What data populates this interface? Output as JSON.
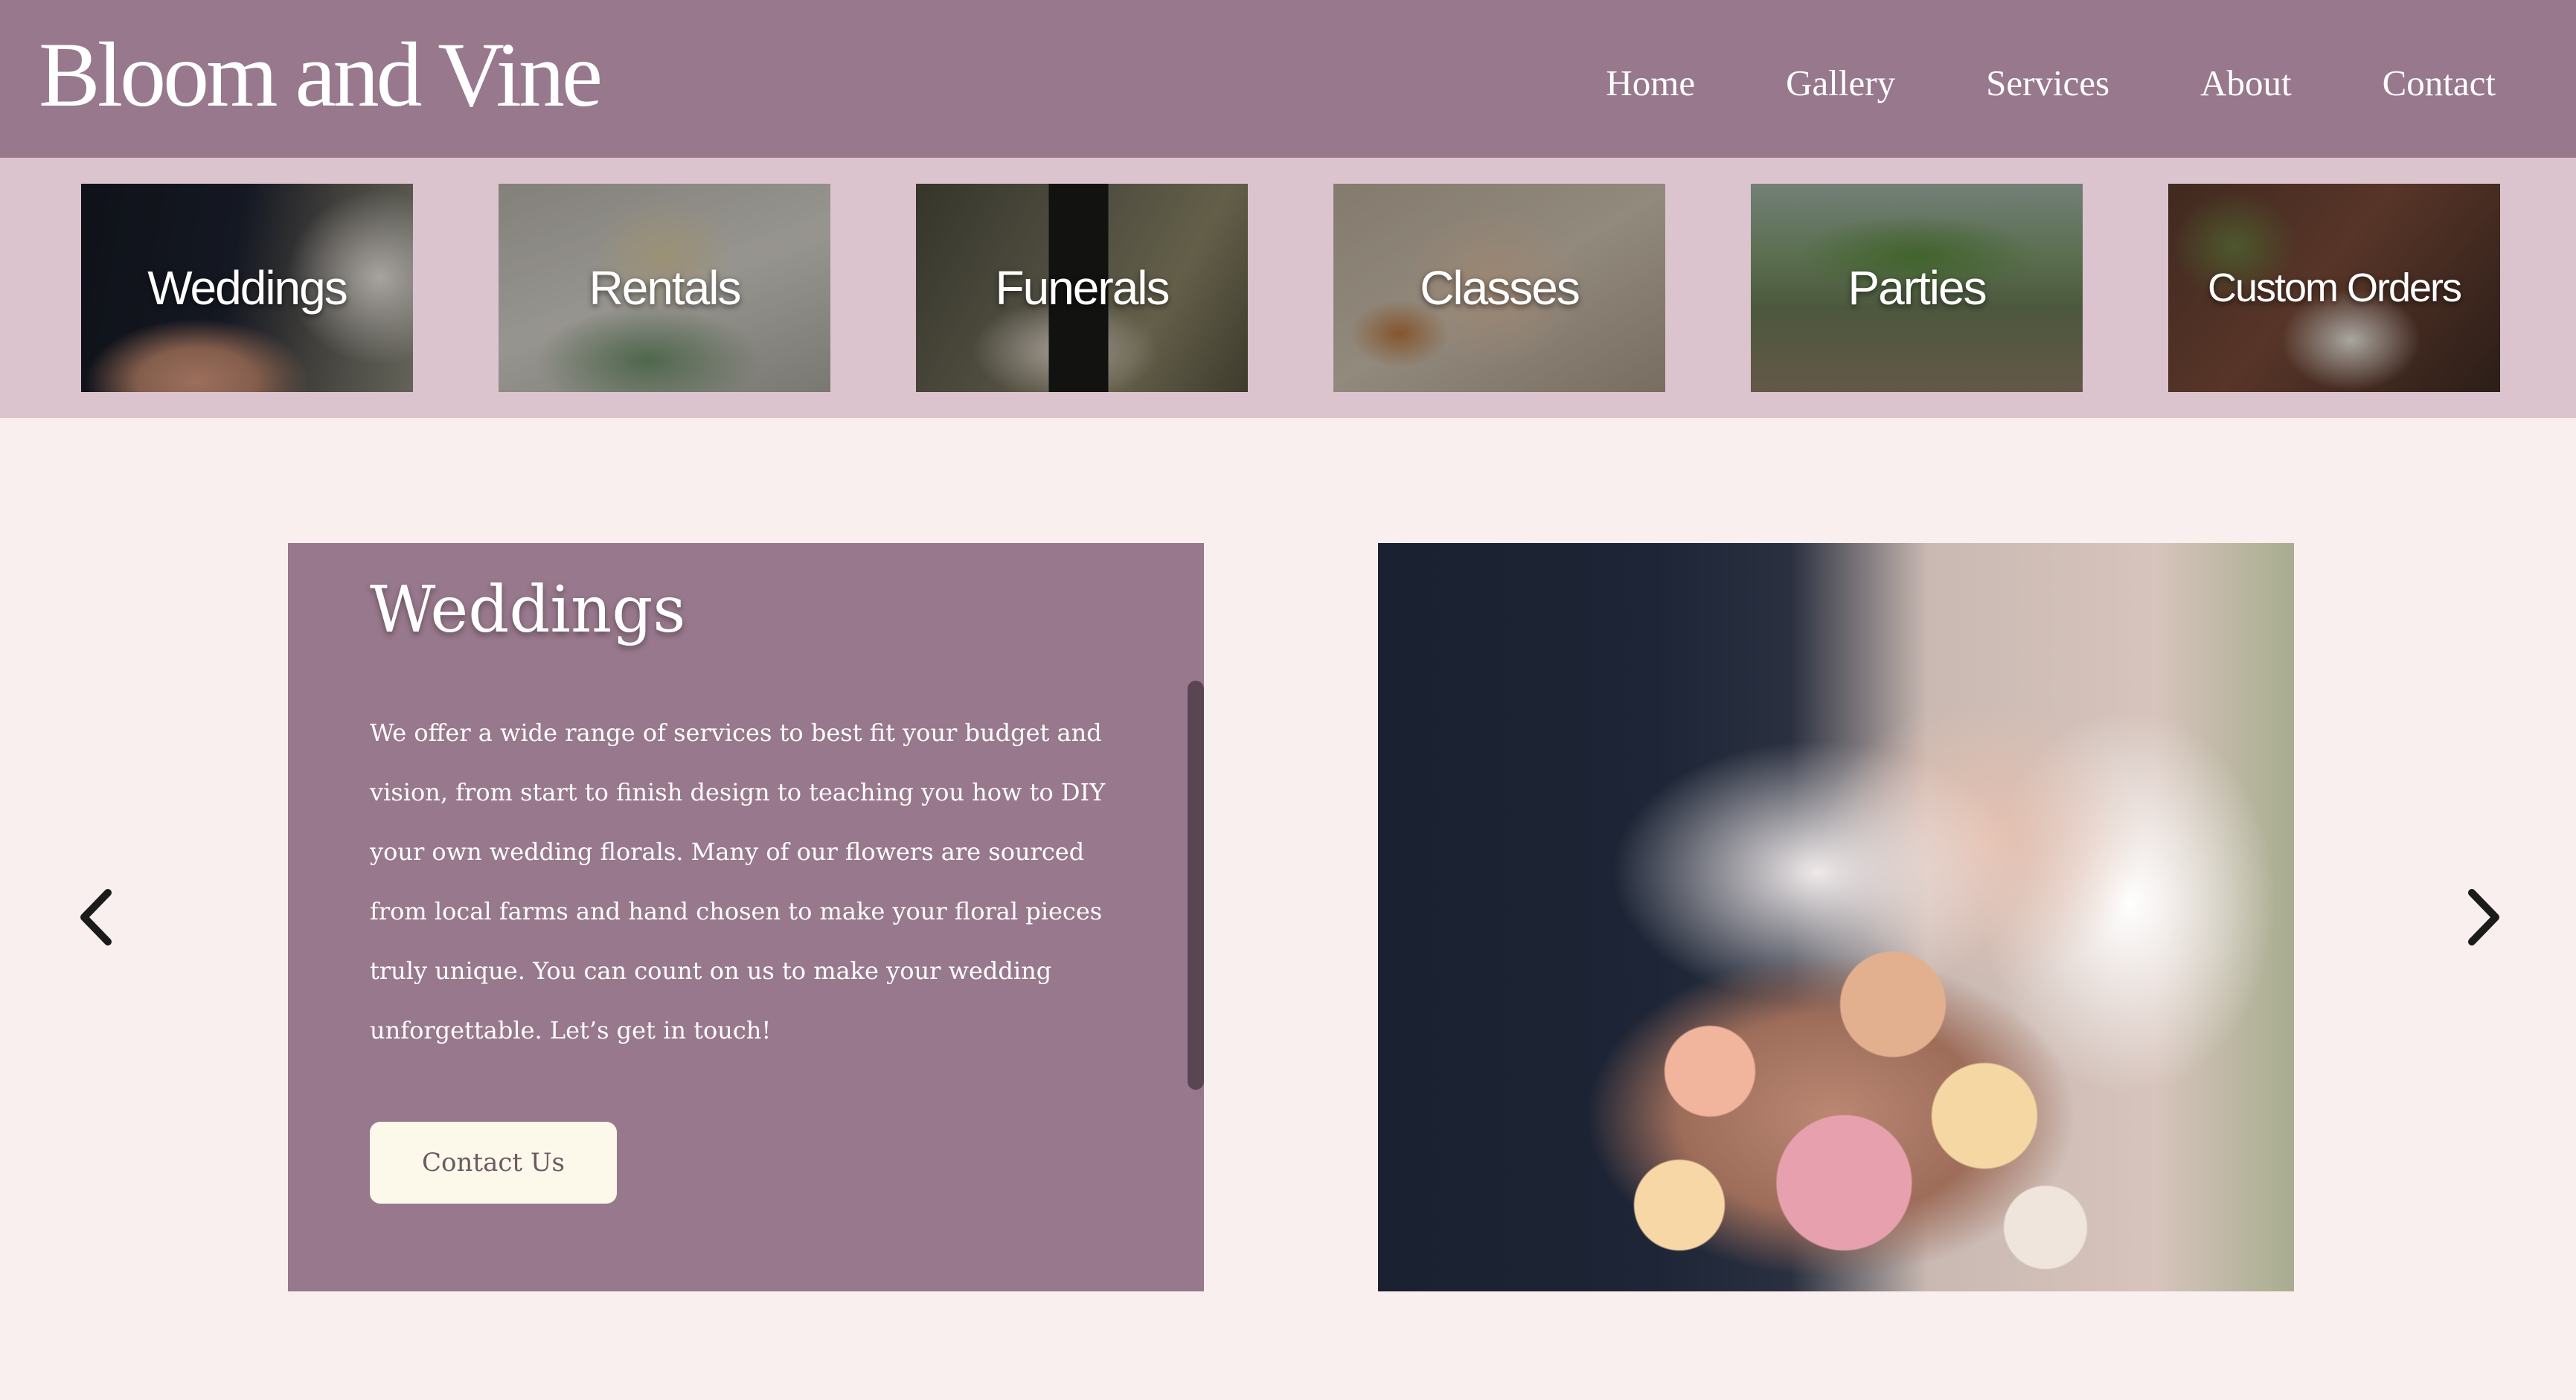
{
  "brand": {
    "logo_text": "Bloom and Vine"
  },
  "nav": {
    "items": [
      {
        "label": "Home"
      },
      {
        "label": "Gallery"
      },
      {
        "label": "Services"
      },
      {
        "label": "About"
      },
      {
        "label": "Contact"
      }
    ]
  },
  "categories": [
    {
      "label": "Weddings"
    },
    {
      "label": "Rentals"
    },
    {
      "label": "Funerals"
    },
    {
      "label": "Classes"
    },
    {
      "label": "Parties"
    },
    {
      "label": "Custom Orders"
    }
  ],
  "feature": {
    "title": "Weddings",
    "body": "We offer a wide range of services to best fit your budget and vision, from start to finish design to teaching you how to DIY your own wedding florals. Many of our flowers are sourced from local farms and hand chosen to make your floral pieces truly unique. You can count on us to make your wedding unforgettable. Let’s get in touch!",
    "cta_label": "Contact Us"
  },
  "carousel": {
    "prev_icon": "chevron-left-icon",
    "next_icon": "chevron-right-icon"
  },
  "colors": {
    "header_bg": "#98788c",
    "strip_bg": "#dcc4cf",
    "page_bg": "#f9efee",
    "button_bg": "#fcf8ea"
  }
}
